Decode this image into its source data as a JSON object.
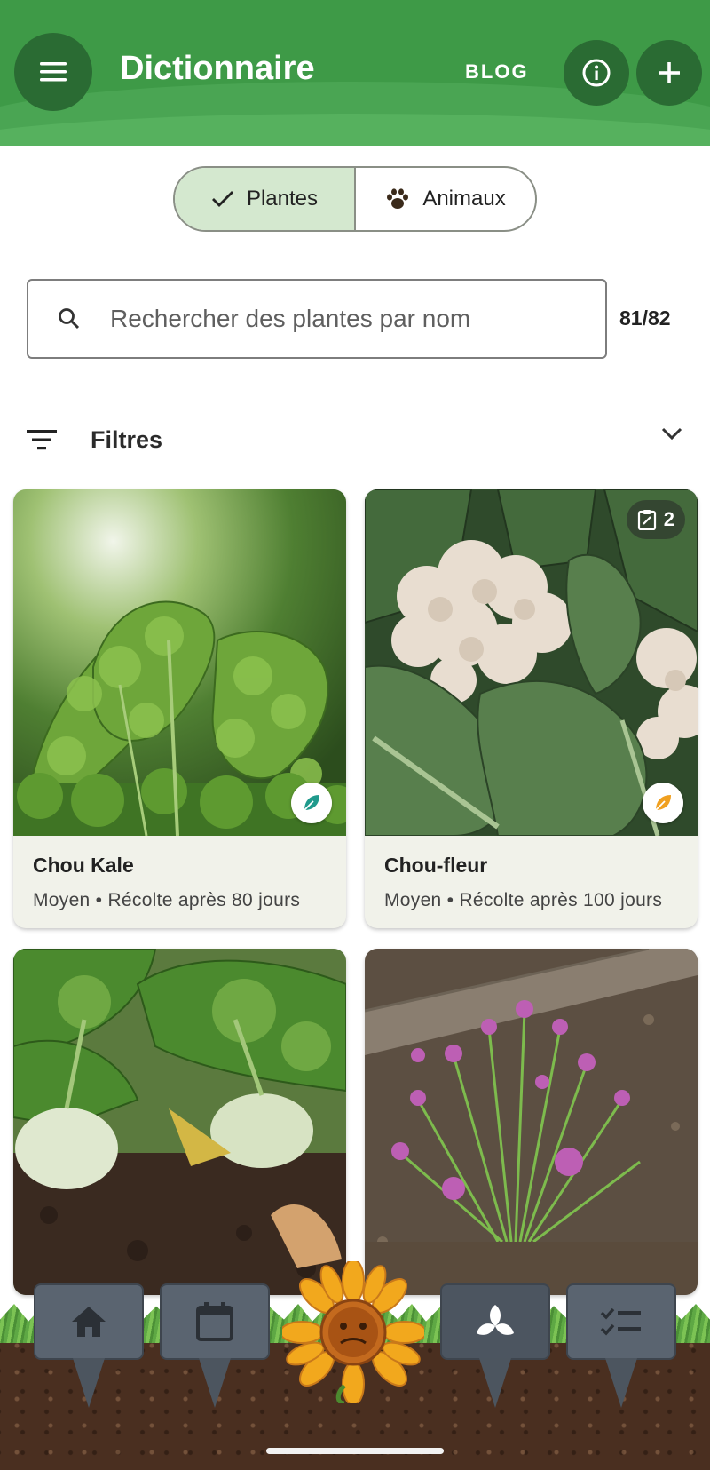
{
  "header": {
    "title": "Dictionnaire",
    "blog_label": "BLOG",
    "menu_icon": "menu-icon",
    "info_icon": "info-icon",
    "add_icon": "add-icon",
    "background": "#3e9a47"
  },
  "toggle": {
    "options": [
      {
        "label": "Plantes",
        "icon": "check-icon",
        "selected": true
      },
      {
        "label": "Animaux",
        "icon": "paw-icon",
        "selected": false
      }
    ],
    "selected_color": "#d4e8cf"
  },
  "search": {
    "placeholder": "Rechercher des plantes par nom",
    "value": "",
    "count": "81/82"
  },
  "filters": {
    "label": "Filtres",
    "expanded": false
  },
  "cards": [
    {
      "name": "Chou Kale",
      "meta": "Moyen • Récolte après 80 jours",
      "badge_color": "#1f9a8c",
      "tasks": ""
    },
    {
      "name": "Chou-fleur",
      "meta": "Moyen • Récolte après 100 jours",
      "badge_color": "#f0a020",
      "tasks": "2"
    },
    {
      "name": "",
      "meta": "",
      "badge_color": "",
      "tasks": ""
    },
    {
      "name": "",
      "meta": "",
      "badge_color": "",
      "tasks": ""
    }
  ],
  "bottom_nav": {
    "items": [
      {
        "icon": "home-icon",
        "selected": false
      },
      {
        "icon": "calendar-icon",
        "selected": false
      },
      {
        "icon": "sunflower-icon",
        "selected": false
      },
      {
        "icon": "sprout-icon",
        "selected": true
      },
      {
        "icon": "checklist-icon",
        "selected": false
      }
    ]
  }
}
